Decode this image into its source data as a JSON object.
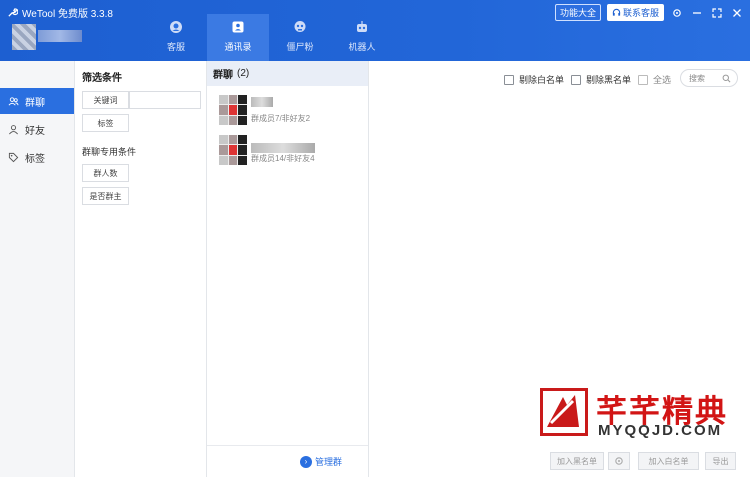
{
  "app": {
    "title": "WeTool 免费版 3.3.8"
  },
  "nav": {
    "tabs": [
      {
        "label": "客服",
        "icon": "headset-icon"
      },
      {
        "label": "通讯录",
        "icon": "contacts-icon"
      },
      {
        "label": "僵尸粉",
        "icon": "zombie-icon"
      },
      {
        "label": "机器人",
        "icon": "robot-icon"
      }
    ]
  },
  "topbar": {
    "func_label": "功能大全",
    "contact_label": "联系客服"
  },
  "sidebar": {
    "items": [
      {
        "label": "群聊",
        "icon": "group-icon"
      },
      {
        "label": "好友",
        "icon": "person-icon"
      },
      {
        "label": "标签",
        "icon": "tag-icon"
      }
    ]
  },
  "filter": {
    "title": "筛选条件",
    "keyword_label": "关键词",
    "tag_label": "标签",
    "group_title": "群聊专用条件",
    "member_count_label": "群人数",
    "is_owner_label": "是否群主"
  },
  "group_list": {
    "title": "群聊",
    "count": "(2)",
    "items": [
      {
        "meta": "群成员7/非好友2"
      },
      {
        "meta": "群成员14/非好友4"
      }
    ],
    "manage_label": "管理群"
  },
  "main": {
    "remove_whitelist": "剔除白名单",
    "remove_blacklist": "剔除黑名单",
    "select_all": "全选",
    "search_placeholder": "搜索",
    "add_blacklist": "加入黑名单",
    "add_whitelist": "加入白名单",
    "export": "导出"
  },
  "watermark": {
    "brand": "芊芊精典",
    "url": "MYQQJD.COM"
  },
  "colors": {
    "primary": "#2a6fe0",
    "header": "#1d5fd1",
    "watermark": "#d21515"
  }
}
